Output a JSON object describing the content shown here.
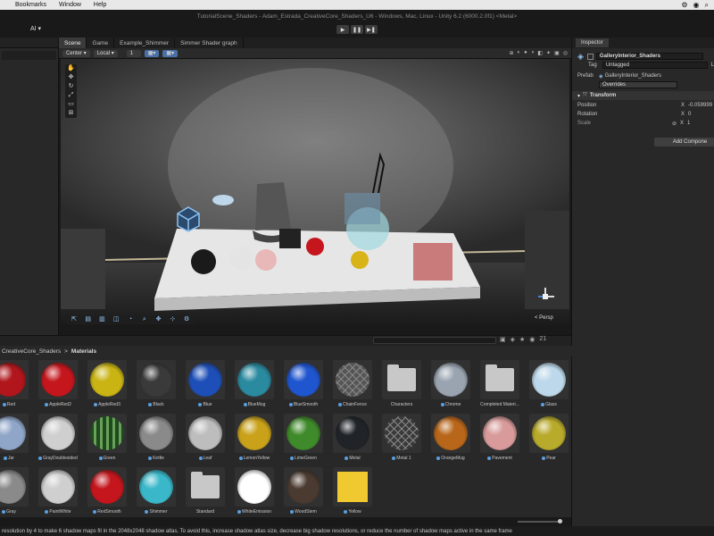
{
  "mac_menu": [
    "Help",
    "Bookmarks",
    "Window",
    "Help"
  ],
  "mac_menu_visible": [
    "Edit",
    "Bookmarks",
    "Window",
    "Help"
  ],
  "window_title": "TutorialScene_Shaders - Adam_Estrada_CreativeCore_Shaders_U6 - Windows, Mac, Linux - Unity 6.2 (6000.2.0f1) <Metal>",
  "toolbar": {
    "ai_label": "AI ▾"
  },
  "scene_tabs": [
    "Scene",
    "Game",
    "Example_Shimmer",
    "Simmer Shader graph"
  ],
  "scene_toolbar": {
    "pivot": "Center",
    "space": "Local",
    "grid_value": "1"
  },
  "viewport": {
    "persp_label": "< Persp",
    "axis_z": "z"
  },
  "inspector": {
    "tab": "Inspector",
    "object_name": "GalleryInterior_Shaders",
    "tag_label": "Tag",
    "tag_value": "Untagged",
    "layer_short": "L",
    "prefab_label": "Prefab",
    "prefab_value": "GalleryInterior_Shaders",
    "overrides": "Overrides",
    "transform": "Transform",
    "position_label": "Position",
    "position_x": "-0.059999",
    "rotation_label": "Rotation",
    "rotation_x": "0",
    "scale_label": "Scale",
    "scale_x": "1",
    "x_label": "X",
    "add_component": "Add Compone"
  },
  "project": {
    "breadcrumb_root": "CreativeCore_Shaders",
    "breadcrumb_sep": ">",
    "breadcrumb_current": "Materials",
    "count": "21"
  },
  "materials": [
    {
      "label": "Red",
      "color": "#b0161c",
      "kind": "sphere"
    },
    {
      "label": "AppleRed2",
      "color": "#c4161c",
      "kind": "sphere"
    },
    {
      "label": "AppleRed3",
      "color": "#c9b413",
      "kind": "sphere"
    },
    {
      "label": "Black",
      "color": "#3a3a3a",
      "kind": "sphere"
    },
    {
      "label": "Blue",
      "color": "#1e4fb8",
      "kind": "sphere"
    },
    {
      "label": "BlueMug",
      "color": "#2a8aa0",
      "kind": "sphere"
    },
    {
      "label": "BlueSmooth",
      "color": "#1f55cf",
      "kind": "sphere"
    },
    {
      "label": "ChainFence",
      "color": "#555555",
      "kind": "fence"
    },
    {
      "label": "Characters",
      "color": "#c8c8c8",
      "kind": "folder"
    },
    {
      "label": "Chrome",
      "color": "#9aa4b0",
      "kind": "sphere"
    },
    {
      "label": "Completed Materi...",
      "color": "#c8c8c8",
      "kind": "folder"
    },
    {
      "label": "Glass",
      "color": "#bcd8ea",
      "kind": "sphere"
    },
    {
      "label": "Jar",
      "color": "#8fa6c9",
      "kind": "sphere"
    },
    {
      "label": "GrayDoublesided",
      "color": "#cfcfcf",
      "kind": "sphere"
    },
    {
      "label": "Green",
      "color": "#2f6a2f",
      "kind": "stripes"
    },
    {
      "label": "Kettle",
      "color": "#8a8a8a",
      "kind": "sphere"
    },
    {
      "label": "Leaf",
      "color": "#bdbdbd",
      "kind": "sphere"
    },
    {
      "label": "LemonYellow",
      "color": "#c9a21a",
      "kind": "sphere"
    },
    {
      "label": "LimeGreen",
      "color": "#3f8a2a",
      "kind": "sphere"
    },
    {
      "label": "Metal",
      "color": "#202428",
      "kind": "sphere"
    },
    {
      "label": "Metal 1",
      "color": "#3a3a3a",
      "kind": "fence"
    },
    {
      "label": "OrangeMug",
      "color": "#b8661a",
      "kind": "sphere"
    },
    {
      "label": "Pavement",
      "color": "#d89a9a",
      "kind": "sphere"
    },
    {
      "label": "Pear",
      "color": "#b8aa2a",
      "kind": "sphere"
    },
    {
      "label": "Gray",
      "color": "#8a8a8a",
      "kind": "sphere"
    },
    {
      "label": "PaintWhite",
      "color": "#cfcfcf",
      "kind": "sphere"
    },
    {
      "label": "RedSmooth",
      "color": "#c4161c",
      "kind": "sphere"
    },
    {
      "label": "Shimmer",
      "color": "#3ab8c9",
      "kind": "sphere"
    },
    {
      "label": "Standard",
      "color": "#c8c8c8",
      "kind": "folder"
    },
    {
      "label": "WhiteEmission",
      "color": "#ffffff",
      "kind": "sphere"
    },
    {
      "label": "WoodStem",
      "color": "#4a3a30",
      "kind": "sphere"
    },
    {
      "label": "Yellow",
      "color": "#f0c830",
      "kind": "square"
    }
  ],
  "status_message": "resolution by 4 to make 6 shadow maps fit in the 2048x2048 shadow atlas. To avoid this, increase shadow atlas size, decrease big shadow resolutions, or reduce the number of shadow maps active in the same frame"
}
